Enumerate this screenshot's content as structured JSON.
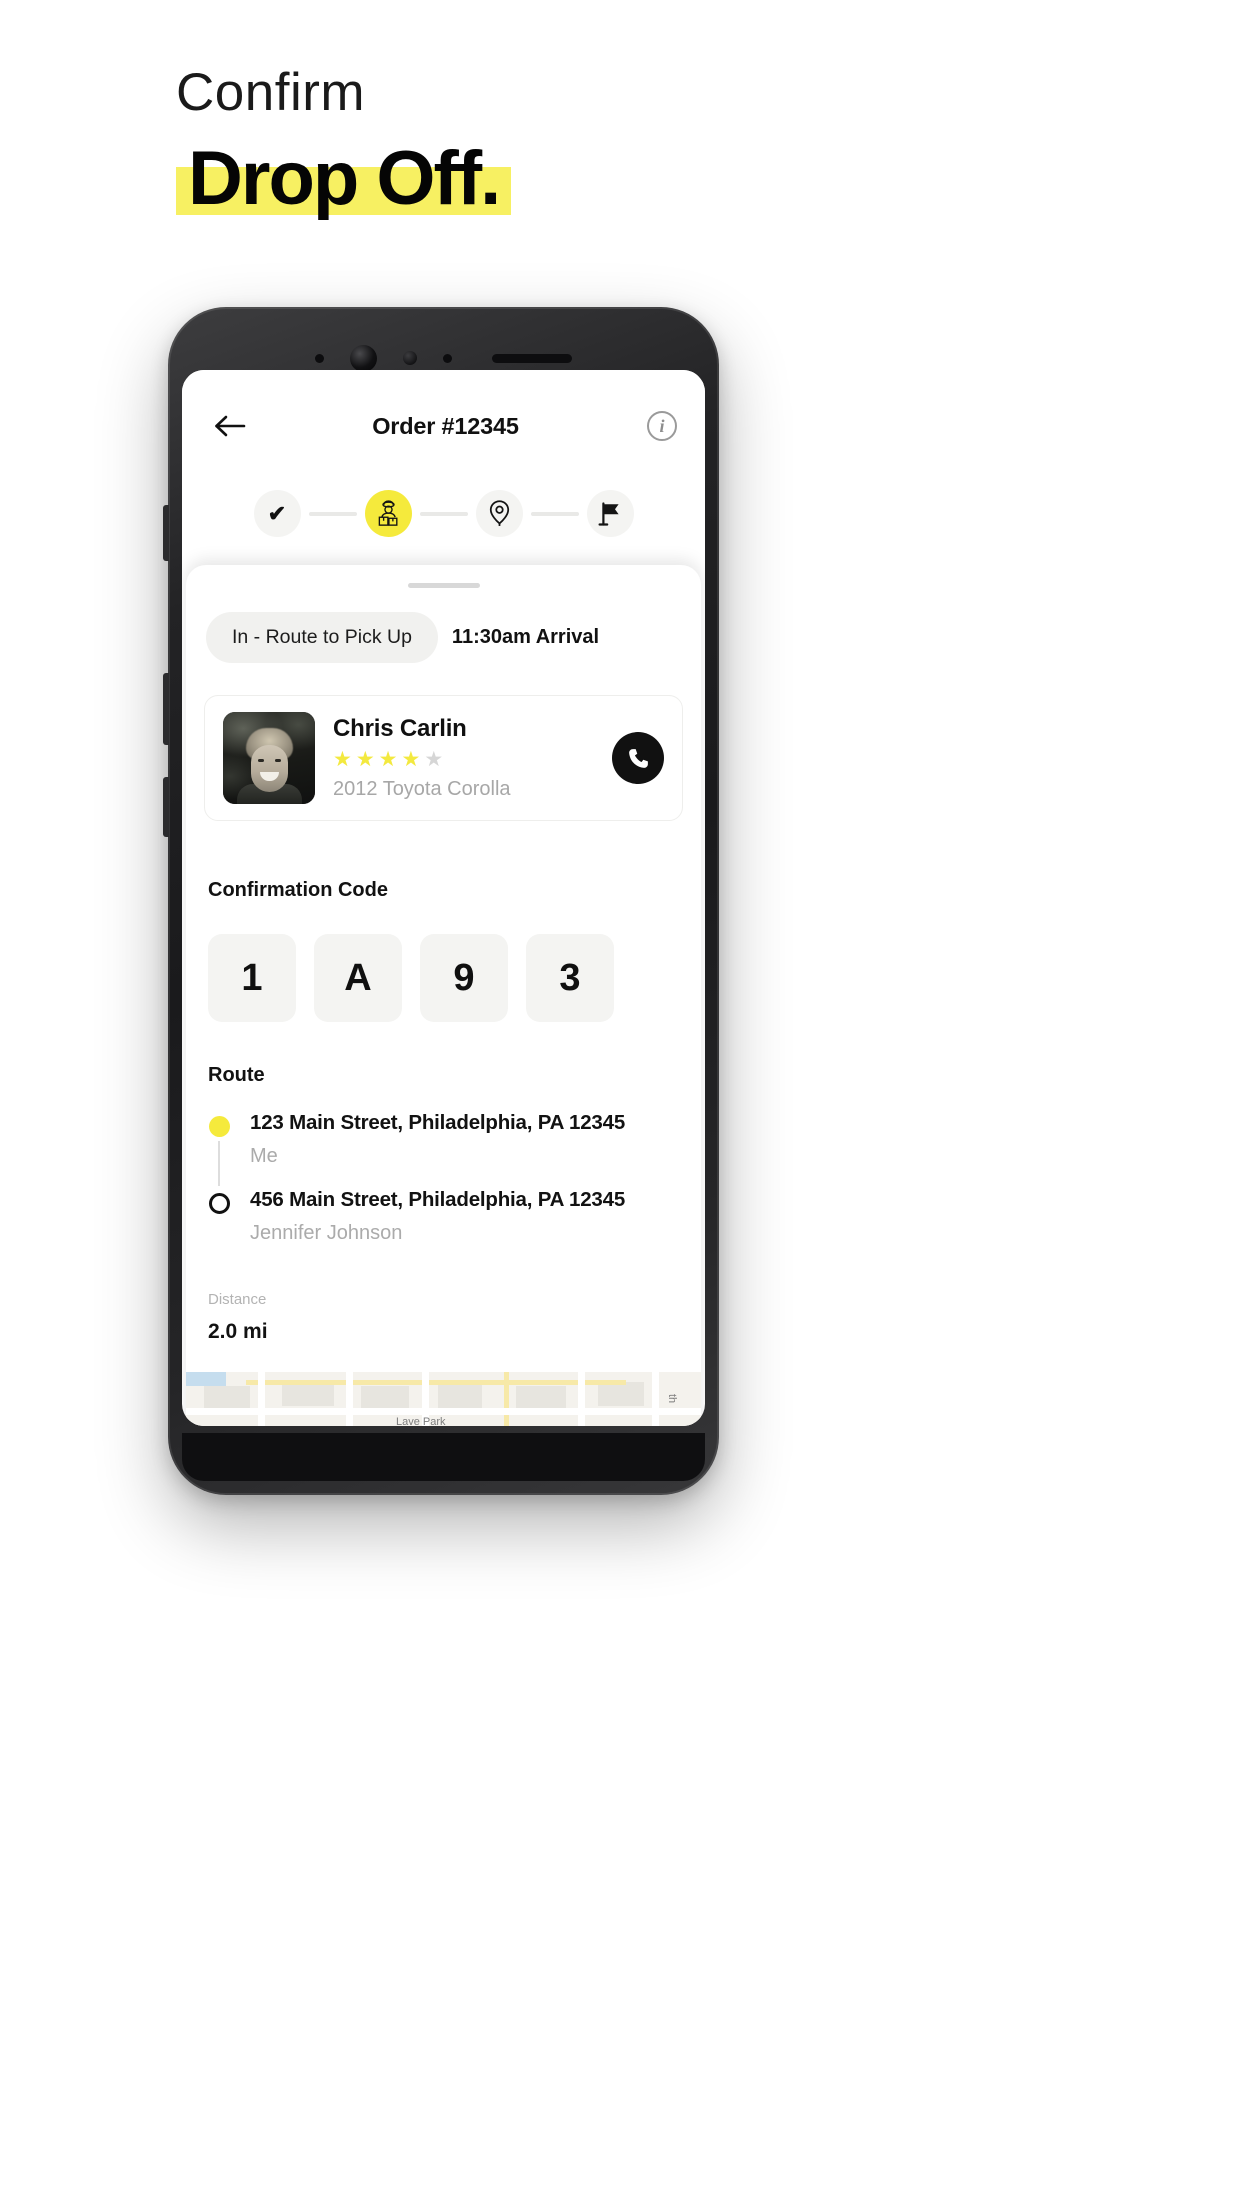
{
  "headline": {
    "eyebrow": "Confirm",
    "main": "Drop Off.",
    "highlight_color": "#f7f062"
  },
  "app": {
    "header": {
      "back_icon": "arrow-left-icon",
      "title": "Order #12345",
      "info_icon": "info-circle-icon",
      "info_glyph": "i"
    },
    "stepper": {
      "steps": [
        {
          "id": "order-placed",
          "icon": "check-icon",
          "glyph": "✔",
          "state": "complete"
        },
        {
          "id": "in-route-pickup",
          "icon": "delivery-person-icon",
          "state": "active"
        },
        {
          "id": "drop-off-location",
          "icon": "map-pin-icon",
          "state": "upcoming"
        },
        {
          "id": "delivered",
          "icon": "flag-icon",
          "state": "upcoming"
        }
      ],
      "active_color": "#f5ea3c",
      "inactive_color": "#f4f4f2"
    },
    "sheet": {
      "status_pill": "In - Route to Pick Up",
      "arrival": "11:30am Arrival",
      "driver": {
        "name": "Chris Carlin",
        "rating": 4,
        "rating_max": 5,
        "vehicle": "2012 Toyota Corolla",
        "avatar_name": "driver-photo",
        "call_icon": "phone-icon"
      },
      "confirmation": {
        "label": "Confirmation Code",
        "digits": [
          "1",
          "A",
          "9",
          "3"
        ]
      },
      "route": {
        "label": "Route",
        "stops": [
          {
            "address": "123 Main Street, Philadelphia, PA 12345",
            "person": "Me",
            "marker": "filled"
          },
          {
            "address": "456 Main Street, Philadelphia, PA 12345",
            "person": "Jennifer Johnson",
            "marker": "hollow"
          }
        ]
      },
      "distance": {
        "label": "Distance",
        "value": "2.0 mi"
      },
      "map": {
        "labels": [
          "Lave Park",
          "th"
        ]
      }
    }
  }
}
